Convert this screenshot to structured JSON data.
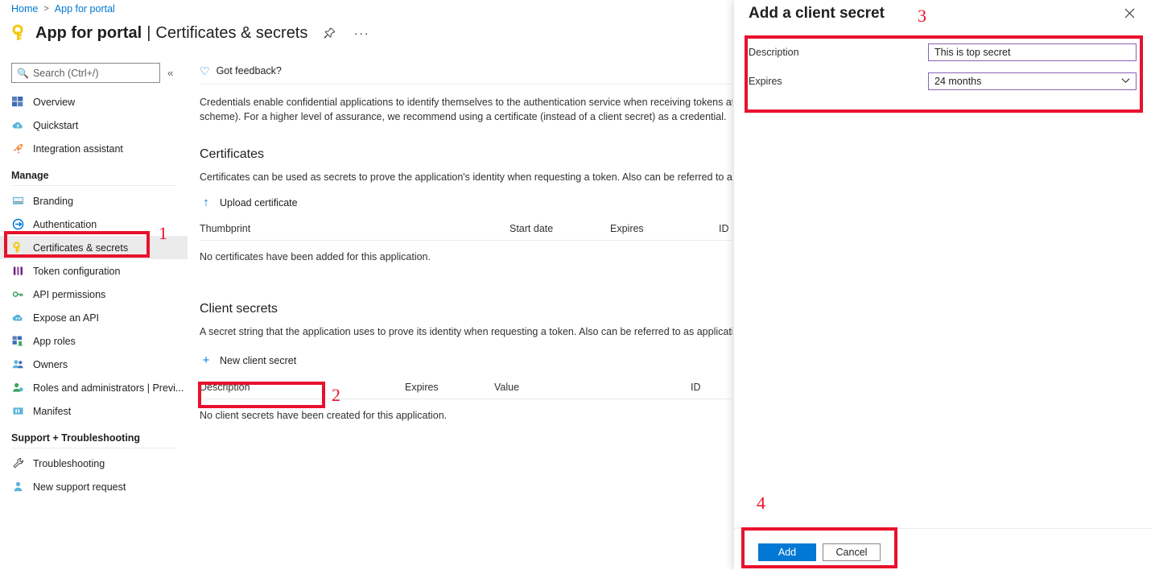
{
  "breadcrumb": {
    "home": "Home",
    "separator": ">",
    "current": "App for portal"
  },
  "header": {
    "app_name": "App for portal",
    "separator": "|",
    "page_section": "Certificates & secrets",
    "pin_icon": "pin-icon",
    "more_icon": "ellipsis-icon",
    "key_icon": "key-icon"
  },
  "sidebar": {
    "search": {
      "placeholder": "Search (Ctrl+/)",
      "icon": "search-icon"
    },
    "collapse_icon": "«",
    "items": [
      {
        "label": "Overview",
        "icon": "overview-grid-icon",
        "selected": false
      },
      {
        "label": "Quickstart",
        "icon": "cloud-lightning-icon",
        "selected": false
      },
      {
        "label": "Integration assistant",
        "icon": "rocket-icon",
        "selected": false
      }
    ],
    "groups": [
      {
        "label": "Manage",
        "items": [
          {
            "label": "Branding",
            "icon": "branding-icon",
            "selected": false
          },
          {
            "label": "Authentication",
            "icon": "authentication-icon",
            "selected": false
          },
          {
            "label": "Certificates & secrets",
            "icon": "key-icon",
            "selected": true
          },
          {
            "label": "Token configuration",
            "icon": "token-bars-icon",
            "selected": false
          },
          {
            "label": "API permissions",
            "icon": "api-permissions-icon",
            "selected": false
          },
          {
            "label": "Expose an API",
            "icon": "expose-api-icon",
            "selected": false
          },
          {
            "label": "App roles",
            "icon": "app-roles-icon",
            "selected": false
          },
          {
            "label": "Owners",
            "icon": "owners-people-icon",
            "selected": false
          },
          {
            "label": "Roles and administrators | Previ...",
            "icon": "roles-admin-icon",
            "selected": false
          },
          {
            "label": "Manifest",
            "icon": "manifest-icon",
            "selected": false
          }
        ]
      },
      {
        "label": "Support + Troubleshooting",
        "items": [
          {
            "label": "Troubleshooting",
            "icon": "wrench-icon",
            "selected": false
          },
          {
            "label": "New support request",
            "icon": "support-person-icon",
            "selected": false
          }
        ]
      }
    ]
  },
  "content": {
    "feedback_button": {
      "label": "Got feedback?",
      "icon": "heart-icon"
    },
    "intro": "Credentials enable confidential applications to identify themselves to the authentication service when receiving tokens at a we\nscheme). For a higher level of assurance, we recommend using a certificate (instead of a client secret) as a credential.",
    "certificates": {
      "heading": "Certificates",
      "description": "Certificates can be used as secrets to prove the application's identity when requesting a token. Also can be referred to as publi",
      "upload_button": {
        "label": "Upload certificate",
        "icon": "upload-icon"
      },
      "columns": [
        "Thumbprint",
        "Start date",
        "Expires",
        "ID"
      ],
      "empty_message": "No certificates have been added for this application."
    },
    "client_secrets": {
      "heading": "Client secrets",
      "description": "A secret string that the application uses to prove its identity when requesting a token. Also can be referred to as application pa",
      "new_button": {
        "label": "New client secret",
        "icon": "plus-icon"
      },
      "columns": [
        "Description",
        "Expires",
        "Value",
        "ID"
      ],
      "empty_message": "No client secrets have been created for this application."
    }
  },
  "panel": {
    "title": "Add a client secret",
    "close_icon": "close-icon",
    "fields": [
      {
        "label": "Description",
        "value": "This is top secret",
        "type": "text"
      },
      {
        "label": "Expires",
        "value": "24 months",
        "type": "select",
        "chevron": "chevron-down-icon"
      }
    ],
    "actions": {
      "primary": "Add",
      "secondary": "Cancel"
    }
  },
  "annotations": {
    "color": "#e8112d",
    "numbers": [
      "1",
      "2",
      "3",
      "4"
    ]
  }
}
